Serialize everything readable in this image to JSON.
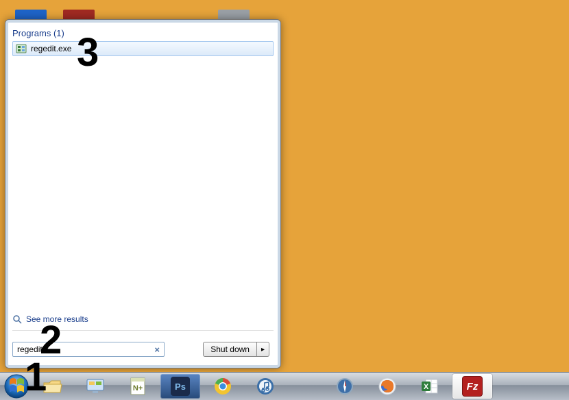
{
  "startMenu": {
    "programsHeader": "Programs (1)",
    "results": [
      {
        "label": "regedit.exe"
      }
    ],
    "seeMore": "See more results",
    "searchValue": "regedit",
    "shutdownLabel": "Shut down",
    "shutdownArrow": "▸"
  },
  "annotations": {
    "n1": "1",
    "n2": "2",
    "n3": "3"
  }
}
